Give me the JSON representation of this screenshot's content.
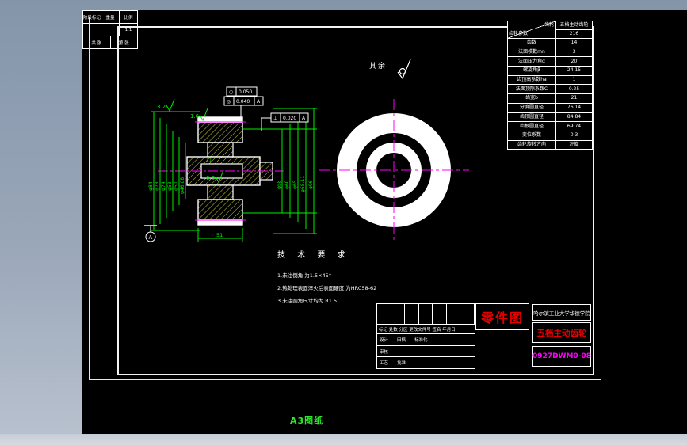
{
  "canvas": {
    "a3_label": "A3图纸"
  },
  "gear_table": {
    "header": {
      "gear": "齿轮",
      "param": "齿轮参数",
      "name": "五档主动齿轮",
      "code": "216"
    },
    "rows": [
      {
        "label": "齿数",
        "value": "14"
      },
      {
        "label": "法面模数mn",
        "value": "3"
      },
      {
        "label": "法面压力角α",
        "value": "20"
      },
      {
        "label": "螺旋角β",
        "value": "24.15"
      },
      {
        "label": "齿顶高系数ha",
        "value": "1"
      },
      {
        "label": "法面顶隙系数C",
        "value": "0.25"
      },
      {
        "label": "齿宽b",
        "value": "21"
      },
      {
        "label": "分度圆直径",
        "value": "76.14"
      },
      {
        "label": "齿顶圆直径",
        "value": "84.84"
      },
      {
        "label": "齿根圆直径",
        "value": "69.74"
      },
      {
        "label": "变位系数",
        "value": "0.3"
      },
      {
        "label": "齿轮旋转方向",
        "value": "左旋"
      }
    ]
  },
  "title_block": {
    "part_type": "零件图",
    "school": "哈尔滨工业大学华德学院",
    "part_name": "五档主动齿轮",
    "drawing_no": "0927DWM0-08",
    "revision_header": "标记 处数 分区 更改文件号 签名 年月日",
    "design": "设计",
    "designer": "田枫",
    "standard": "标准化",
    "audit": "审核",
    "process": "工艺",
    "approve": "批准",
    "stage": "阶段标记",
    "weight": "重量",
    "scale": "比例",
    "scale_value": "1:1",
    "sheet_total": "共 张",
    "sheet_index": "第 张"
  },
  "tech_req": {
    "title": "技 术 要 求",
    "items": [
      "1.未注倒角 为1.5×45°",
      "2.热处理表面淬火后表面硬度 为HRC58-62",
      "3.未注圆角尺寸均为 R1.5"
    ]
  },
  "annotations": {
    "rest": "其余",
    "rough_32": "3.2",
    "rough_16": "1.6",
    "rough_08": "0.8",
    "datum": "A",
    "dim_width": "51",
    "dim_11": "11",
    "tol1_sym": "○",
    "tol1_val": "0.050",
    "tol2_sym": "◎",
    "tol2_val": "0.040",
    "tol2_ref": "A",
    "tol3_sym": "⊥",
    "tol3_val": "0.020",
    "tol3_ref": "A"
  },
  "section": {
    "dims_left": [
      "φ84",
      "φ78",
      "φ74",
      "φ58",
      "φ50",
      "φ46.08"
    ],
    "dims_right": [
      "φ58",
      "φ60",
      "φ65",
      "φ68.11",
      "φ96"
    ]
  },
  "colors": {
    "dimension_green": "#00ef00",
    "centerline_magenta": "#ff00ff",
    "title_red": "#e80000",
    "hatch_yellow": "#cfcf3a"
  }
}
